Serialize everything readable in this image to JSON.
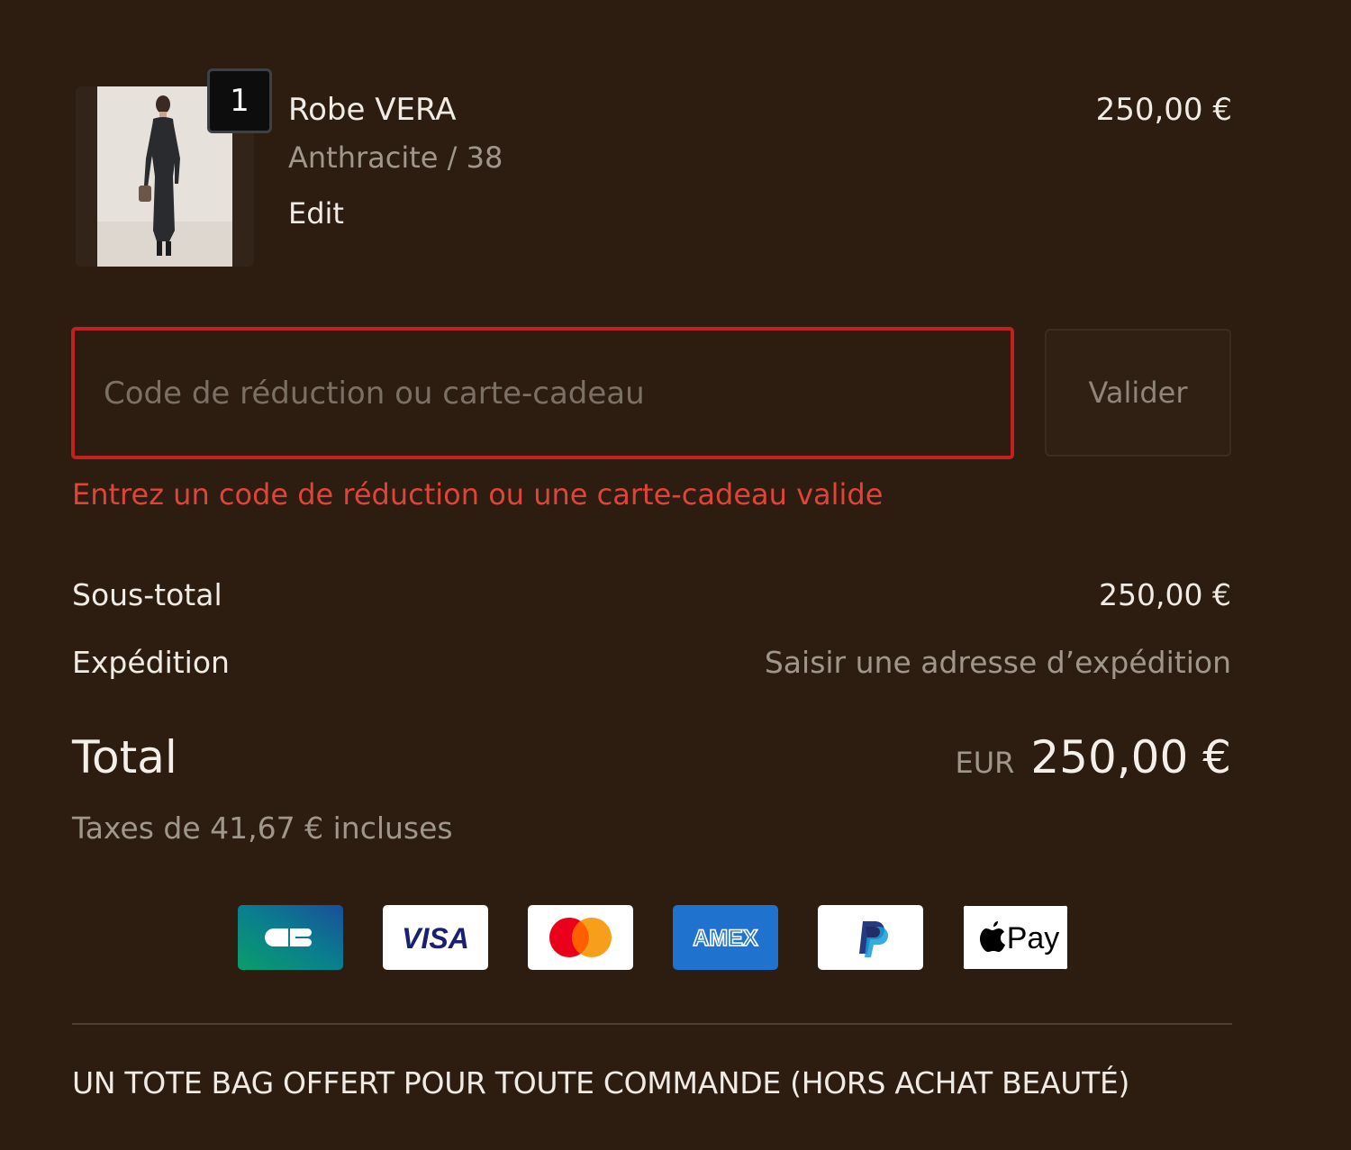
{
  "product": {
    "quantity": "1",
    "name": "Robe VERA",
    "variant": "Anthracite / 38",
    "edit_label": "Edit",
    "price": "250,00 €"
  },
  "discount": {
    "placeholder": "Code de réduction ou carte-cadeau",
    "value": "",
    "apply_label": "Valider",
    "error": "Entrez un code de réduction ou une carte-cadeau valide"
  },
  "summary": {
    "subtotal_label": "Sous-total",
    "subtotal_value": "250,00 €",
    "shipping_label": "Expédition",
    "shipping_value": "Saisir une adresse d’expédition",
    "total_label": "Total",
    "currency": "EUR",
    "total_value": "250,00 €",
    "taxes": "Taxes de 41,67 € incluses"
  },
  "payment_methods": [
    {
      "name": "CB",
      "icon": "cb-card-icon"
    },
    {
      "name": "VISA",
      "icon": "visa-card-icon"
    },
    {
      "name": "Mastercard",
      "icon": "mastercard-icon"
    },
    {
      "name": "AMEX",
      "icon": "amex-card-icon"
    },
    {
      "name": "PayPal",
      "icon": "paypal-icon"
    },
    {
      "name": "Pay",
      "icon": "apple-pay-icon"
    }
  ],
  "promo_banner": "UN TOTE BAG OFFERT POUR TOUTE COMMANDE (HORS ACHAT BEAUTÉ)",
  "colors": {
    "background": "#2d1d10",
    "error": "#e04438",
    "error_border": "#c2221f",
    "muted_text": "#a0978c"
  }
}
